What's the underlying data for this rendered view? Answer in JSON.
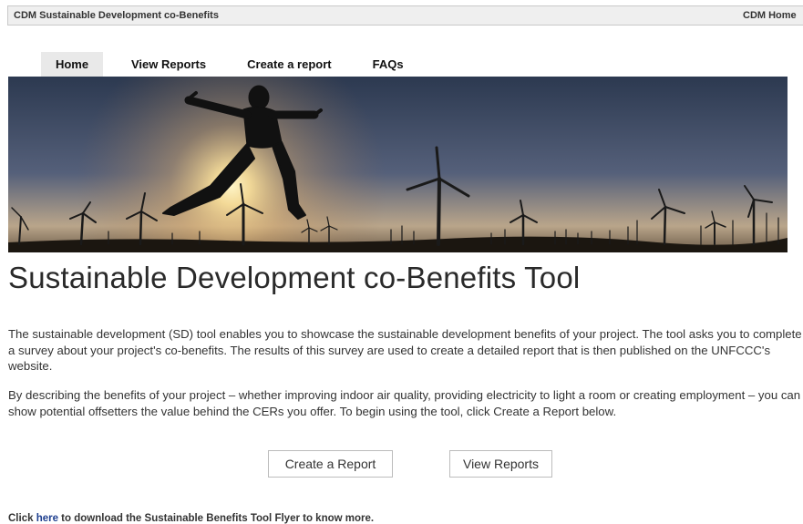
{
  "topbar": {
    "site_title": "CDM Sustainable Development co-Benefits",
    "home_link": "CDM Home"
  },
  "nav": {
    "tabs": [
      {
        "label": "Home",
        "active": true
      },
      {
        "label": "View Reports",
        "active": false
      },
      {
        "label": "Create a report",
        "active": false
      },
      {
        "label": "FAQs",
        "active": false
      }
    ]
  },
  "banner": {
    "icon": "banner-image",
    "description_colors": {
      "sky_top": "#2c3950",
      "sun": "#fff6c8",
      "silhouette": "#111111"
    }
  },
  "main": {
    "heading": "Sustainable Development co-Benefits Tool",
    "paragraph1": "The sustainable development (SD) tool enables you to showcase the sustainable development benefits of your project. The tool asks you to complete a survey about your project's co-benefits. The results of this survey are used to create a detailed report that is then published on the UNFCCC's website.",
    "paragraph2": "By describing the benefits of your project – whether improving indoor air quality, providing electricity to light a room or creating employment – you can show potential offsetters the value behind the CERs you offer. To begin using the tool, click Create a Report below.",
    "create_button": "Create a Report",
    "view_button": "View Reports"
  },
  "footer": {
    "prefix": "Click ",
    "link": "here",
    "suffix": " to download the Sustainable Benefits Tool Flyer to know more."
  },
  "colors": {
    "link": "#1e3f8f",
    "tab_active_bg": "#e9e9e9",
    "topbar_bg": "#efefef"
  }
}
